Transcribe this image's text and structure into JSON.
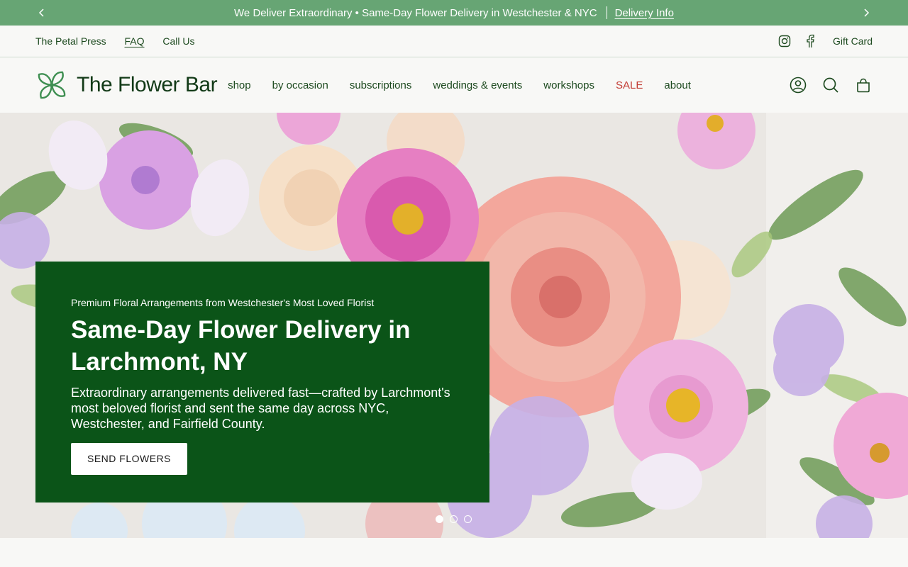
{
  "announcement": {
    "text": "We Deliver Extraordinary • Same-Day Flower Delivery in Westchester & NYC",
    "link": "Delivery Info"
  },
  "utility": {
    "links": [
      "The Petal Press",
      "FAQ",
      "Call Us"
    ],
    "gift_card": "Gift Card"
  },
  "header": {
    "logo": "The Flower Bar",
    "nav": [
      "shop",
      "by occasion",
      "subscriptions",
      "weddings & events",
      "workshops",
      "SALE",
      "about"
    ]
  },
  "hero": {
    "kicker": "Premium Floral Arrangements from Westchester's Most Loved Florist",
    "title": "Same-Day Flower Delivery in Larchmont, NY",
    "body": "Extraordinary arrangements delivered fast—crafted by Larchmont's most beloved florist and sent the same day across NYC, Westchester, and Fairfield County.",
    "cta": "SEND FLOWERS",
    "slides": 3,
    "active_slide": 1
  },
  "colors": {
    "announcement_bg": "#67a574",
    "panel_bg": "#0b5418",
    "sale": "#c23b33",
    "text_green": "#1d4a1f"
  }
}
